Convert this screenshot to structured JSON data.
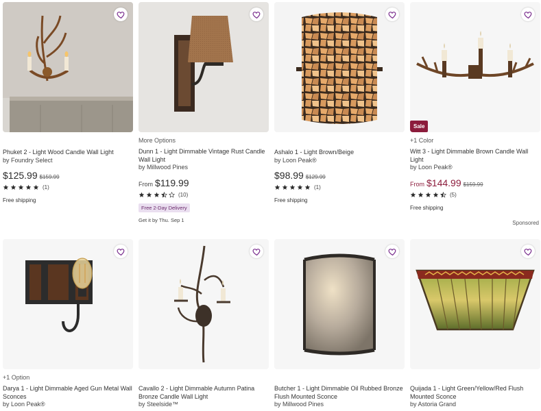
{
  "accent_color": "#8c1c3c",
  "heart_color": "#7a2e8e",
  "sponsored_label": "Sponsored",
  "products": [
    {
      "title": "Phuket 2 - Light Wood Candle Wall Light",
      "byline": "by Foundry Select",
      "price": "$125.99",
      "was_price": "$159.99",
      "rating": 5,
      "reviews": "(1)",
      "shipping": "Free shipping"
    },
    {
      "meta": "More Options",
      "title": "Dunn 1 - Light Dimmable Vintage Rust Candle Wall Light",
      "byline": "by Millwood Pines",
      "from": "From",
      "price": "$119.99",
      "rating": 3.5,
      "reviews": "(10)",
      "delivery_badge": "Free 2-Day Delivery",
      "get_it": "Get it by Thu. Sep 1"
    },
    {
      "title": "Ashalo 1 - Light Brown/Beige",
      "byline": "by Loon Peak®",
      "price": "$98.99",
      "was_price": "$129.99",
      "rating": 5,
      "reviews": "(1)",
      "shipping": "Free shipping"
    },
    {
      "badge": "Sale",
      "meta": "+1 Color",
      "title": "Witt 3 - Light Dimmable Brown Candle Wall Light",
      "byline": "by Loon Peak®",
      "from": "From",
      "price": "$144.99",
      "was_price": "$159.99",
      "rating": 4.5,
      "reviews": "(5)",
      "shipping": "Free shipping"
    },
    {
      "meta": "+1 Option",
      "title": "Darya 1 - Light Dimmable Aged Gun Metal Wall Sconces",
      "byline": "by Loon Peak®"
    },
    {
      "title": "Cavallo 2 - Light Dimmable Autumn Patina Bronze Candle Wall Light",
      "byline": "by Steelside™"
    },
    {
      "title": "Butcher 1 - Light Dimmable Oil Rubbed Bronze Flush Mounted Sconce",
      "byline": "by Millwood Pines"
    },
    {
      "title": "Quijada 1 - Light Green/Yellow/Red Flush Mounted Sconce",
      "byline": "by Astoria Grand"
    }
  ]
}
